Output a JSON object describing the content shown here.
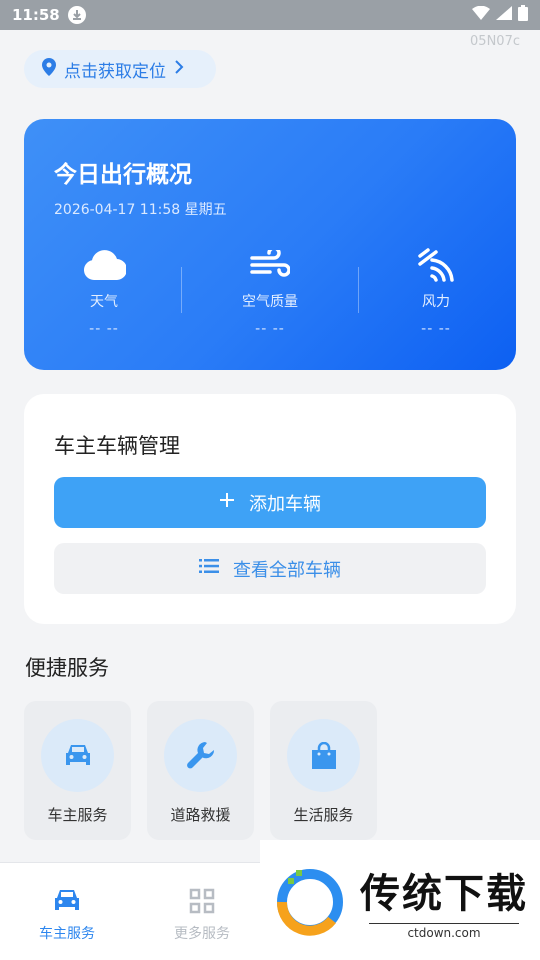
{
  "status_bar": {
    "time": "11:58"
  },
  "version": "05N07c",
  "location": {
    "label": "点击获取定位"
  },
  "overview": {
    "title": "今日出行概况",
    "datetime": "2026-04-17 11:58 星期五",
    "metrics": [
      {
        "label": "天气",
        "value": "-- --",
        "icon": "cloud-icon"
      },
      {
        "label": "空气质量",
        "value": "-- --",
        "icon": "wind-icon"
      },
      {
        "label": "风力",
        "value": "-- --",
        "icon": "wind-force-icon"
      }
    ],
    "gradient": [
      "#3f90f7",
      "#0d60f2"
    ]
  },
  "vehicle": {
    "title": "车主车辆管理",
    "add_label": "添加车辆",
    "view_label": "查看全部车辆"
  },
  "services": {
    "title": "便捷服务",
    "items": [
      {
        "label": "车主服务",
        "icon": "car-icon"
      },
      {
        "label": "道路救援",
        "icon": "wrench-icon"
      },
      {
        "label": "生活服务",
        "icon": "shopping-bag-icon"
      }
    ]
  },
  "bottom_nav": {
    "items": [
      {
        "label": "车主服务",
        "icon": "car-icon",
        "active": true
      },
      {
        "label": "更多服务",
        "icon": "grid-icon",
        "active": false
      }
    ]
  },
  "watermark": {
    "title": "传统下载",
    "url": "ctdown.com"
  },
  "colors": {
    "accent": "#3ea2f6",
    "active_nav": "#2d86ee",
    "inactive_nav": "#b7bcc3"
  }
}
